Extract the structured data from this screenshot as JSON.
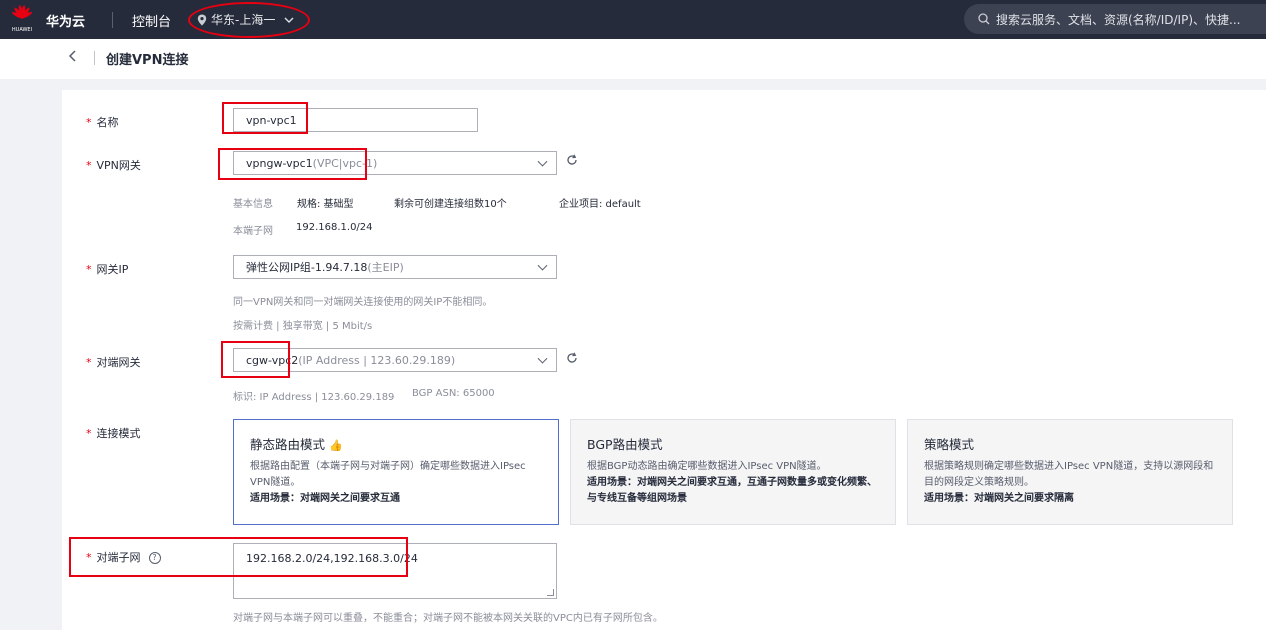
{
  "topbar": {
    "logo_text": "HUAWEI",
    "brand": "华为云",
    "console": "控制台",
    "region": "华东-上海一",
    "search_placeholder": "搜索云服务、文档、资源(名称/ID/IP)、快捷..."
  },
  "page": {
    "title": "创建VPN连接"
  },
  "form": {
    "name": {
      "label": "名称",
      "value": "vpn-vpc1"
    },
    "vpn_gateway": {
      "label": "VPN网关",
      "value": "vpngw-vpc1",
      "value_suffix": "(VPC|vpc-1)",
      "info_label": "基本信息",
      "spec": "规格: 基础型",
      "remaining": "剩余可创建连接组数10个",
      "enterprise": "企业项目: default",
      "local_subnet_label": "本端子网",
      "local_subnet": "192.168.1.0/24"
    },
    "gateway_ip": {
      "label": "网关IP",
      "value": "弹性公网IP组-1.94.7.18",
      "value_suffix": "(主EIP)",
      "hint": "同一VPN网关和同一对端网关连接使用的网关IP不能相同。",
      "billing": "按需计费 | 独享带宽 | 5 Mbit/s"
    },
    "peer_gateway": {
      "label": "对端网关",
      "value": "cgw-vpc2",
      "value_suffix": "(IP Address | 123.60.29.189)",
      "identifier": "标识: IP Address | 123.60.29.189",
      "bgp_asn": "BGP ASN: 65000"
    },
    "connection_mode": {
      "label": "连接模式",
      "cards": [
        {
          "title": "静态路由模式",
          "desc": "根据路由配置（本端子网与对端子网）确定哪些数据进入IPsec VPN隧道。",
          "scene": "适用场景：对端网关之间要求互通"
        },
        {
          "title": "BGP路由模式",
          "desc": "根据BGP动态路由确定哪些数据进入IPsec VPN隧道。",
          "scene": "适用场景：对端网关之间要求互通，互通子网数量多或变化频繁、与专线互备等组网场景"
        },
        {
          "title": "策略模式",
          "desc": "根据策略规则确定哪些数据进入IPsec VPN隧道，支持以源网段和目的网段定义策略规则。",
          "scene": "适用场景：对端网关之间要求隔离"
        }
      ]
    },
    "peer_subnet": {
      "label": "对端子网",
      "value": "192.168.2.0/24,192.168.3.0/24",
      "hint": "对端子网与本端子网可以重叠，不能重合；对端子网不能被本网关关联的VPC内已有子网所包含。"
    }
  },
  "colors": {
    "accent": "#526ecc",
    "annotation": "#e60012",
    "topbar": "#252b3a"
  }
}
